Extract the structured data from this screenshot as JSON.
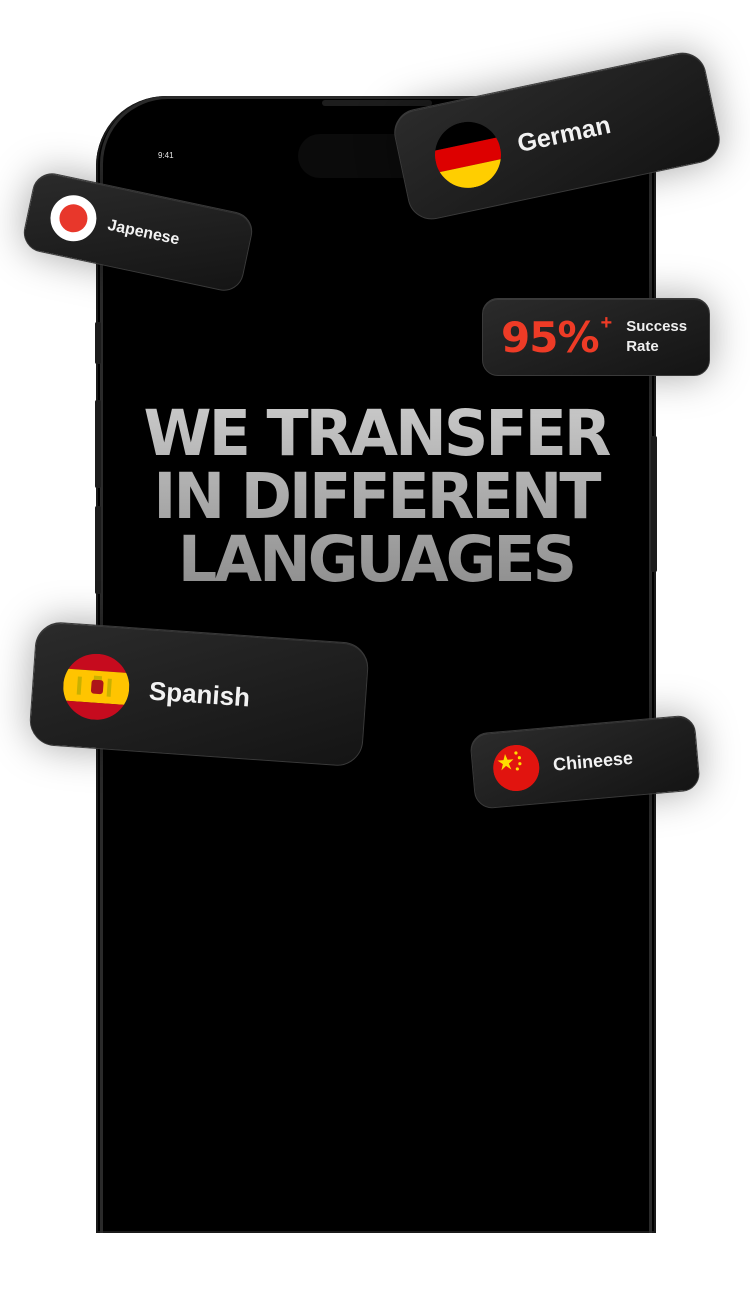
{
  "status_bar": {
    "time": "9:41"
  },
  "headline": {
    "line1": "WE TRANSFER",
    "line2": "IN DIFFERENT",
    "line3": "LANGUAGES"
  },
  "languages": {
    "german": "German",
    "japanese": "Japenese",
    "spanish": "Spanish",
    "chinese": "Chineese"
  },
  "success": {
    "value": "95%",
    "plus": "+",
    "label_line1": "Success",
    "label_line2": "Rate"
  },
  "colors": {
    "accent": "#ee3b26",
    "background": "#000000",
    "pill": "#1e1e1e"
  },
  "icons": {
    "german_flag": "germany-flag-icon",
    "japanese_flag": "japan-flag-icon",
    "spanish_flag": "spain-flag-icon",
    "chinese_flag": "china-flag-icon"
  }
}
